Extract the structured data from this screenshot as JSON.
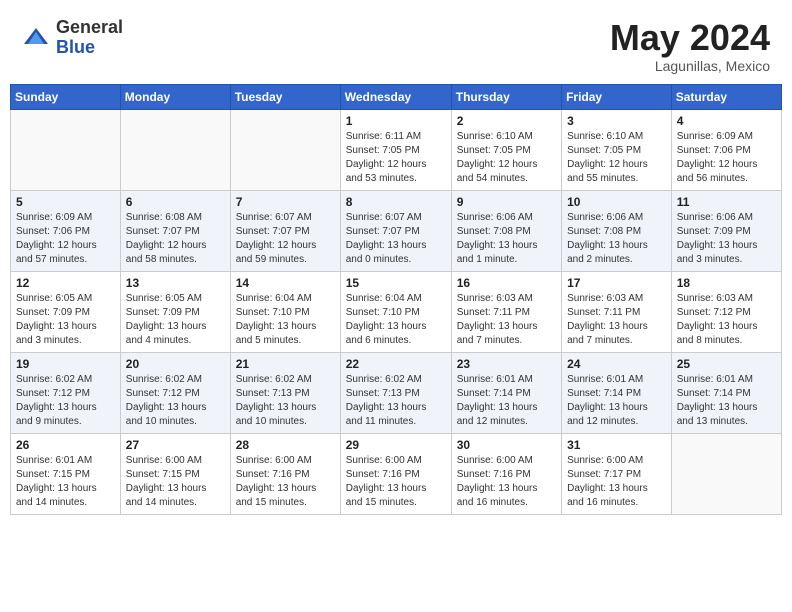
{
  "header": {
    "logo_general": "General",
    "logo_blue": "Blue",
    "month_year": "May 2024",
    "location": "Lagunillas, Mexico"
  },
  "weekdays": [
    "Sunday",
    "Monday",
    "Tuesday",
    "Wednesday",
    "Thursday",
    "Friday",
    "Saturday"
  ],
  "weeks": [
    [
      {
        "day": "",
        "info": ""
      },
      {
        "day": "",
        "info": ""
      },
      {
        "day": "",
        "info": ""
      },
      {
        "day": "1",
        "info": "Sunrise: 6:11 AM\nSunset: 7:05 PM\nDaylight: 12 hours\nand 53 minutes."
      },
      {
        "day": "2",
        "info": "Sunrise: 6:10 AM\nSunset: 7:05 PM\nDaylight: 12 hours\nand 54 minutes."
      },
      {
        "day": "3",
        "info": "Sunrise: 6:10 AM\nSunset: 7:05 PM\nDaylight: 12 hours\nand 55 minutes."
      },
      {
        "day": "4",
        "info": "Sunrise: 6:09 AM\nSunset: 7:06 PM\nDaylight: 12 hours\nand 56 minutes."
      }
    ],
    [
      {
        "day": "5",
        "info": "Sunrise: 6:09 AM\nSunset: 7:06 PM\nDaylight: 12 hours\nand 57 minutes."
      },
      {
        "day": "6",
        "info": "Sunrise: 6:08 AM\nSunset: 7:07 PM\nDaylight: 12 hours\nand 58 minutes."
      },
      {
        "day": "7",
        "info": "Sunrise: 6:07 AM\nSunset: 7:07 PM\nDaylight: 12 hours\nand 59 minutes."
      },
      {
        "day": "8",
        "info": "Sunrise: 6:07 AM\nSunset: 7:07 PM\nDaylight: 13 hours\nand 0 minutes."
      },
      {
        "day": "9",
        "info": "Sunrise: 6:06 AM\nSunset: 7:08 PM\nDaylight: 13 hours\nand 1 minute."
      },
      {
        "day": "10",
        "info": "Sunrise: 6:06 AM\nSunset: 7:08 PM\nDaylight: 13 hours\nand 2 minutes."
      },
      {
        "day": "11",
        "info": "Sunrise: 6:06 AM\nSunset: 7:09 PM\nDaylight: 13 hours\nand 3 minutes."
      }
    ],
    [
      {
        "day": "12",
        "info": "Sunrise: 6:05 AM\nSunset: 7:09 PM\nDaylight: 13 hours\nand 3 minutes."
      },
      {
        "day": "13",
        "info": "Sunrise: 6:05 AM\nSunset: 7:09 PM\nDaylight: 13 hours\nand 4 minutes."
      },
      {
        "day": "14",
        "info": "Sunrise: 6:04 AM\nSunset: 7:10 PM\nDaylight: 13 hours\nand 5 minutes."
      },
      {
        "day": "15",
        "info": "Sunrise: 6:04 AM\nSunset: 7:10 PM\nDaylight: 13 hours\nand 6 minutes."
      },
      {
        "day": "16",
        "info": "Sunrise: 6:03 AM\nSunset: 7:11 PM\nDaylight: 13 hours\nand 7 minutes."
      },
      {
        "day": "17",
        "info": "Sunrise: 6:03 AM\nSunset: 7:11 PM\nDaylight: 13 hours\nand 7 minutes."
      },
      {
        "day": "18",
        "info": "Sunrise: 6:03 AM\nSunset: 7:12 PM\nDaylight: 13 hours\nand 8 minutes."
      }
    ],
    [
      {
        "day": "19",
        "info": "Sunrise: 6:02 AM\nSunset: 7:12 PM\nDaylight: 13 hours\nand 9 minutes."
      },
      {
        "day": "20",
        "info": "Sunrise: 6:02 AM\nSunset: 7:12 PM\nDaylight: 13 hours\nand 10 minutes."
      },
      {
        "day": "21",
        "info": "Sunrise: 6:02 AM\nSunset: 7:13 PM\nDaylight: 13 hours\nand 10 minutes."
      },
      {
        "day": "22",
        "info": "Sunrise: 6:02 AM\nSunset: 7:13 PM\nDaylight: 13 hours\nand 11 minutes."
      },
      {
        "day": "23",
        "info": "Sunrise: 6:01 AM\nSunset: 7:14 PM\nDaylight: 13 hours\nand 12 minutes."
      },
      {
        "day": "24",
        "info": "Sunrise: 6:01 AM\nSunset: 7:14 PM\nDaylight: 13 hours\nand 12 minutes."
      },
      {
        "day": "25",
        "info": "Sunrise: 6:01 AM\nSunset: 7:14 PM\nDaylight: 13 hours\nand 13 minutes."
      }
    ],
    [
      {
        "day": "26",
        "info": "Sunrise: 6:01 AM\nSunset: 7:15 PM\nDaylight: 13 hours\nand 14 minutes."
      },
      {
        "day": "27",
        "info": "Sunrise: 6:00 AM\nSunset: 7:15 PM\nDaylight: 13 hours\nand 14 minutes."
      },
      {
        "day": "28",
        "info": "Sunrise: 6:00 AM\nSunset: 7:16 PM\nDaylight: 13 hours\nand 15 minutes."
      },
      {
        "day": "29",
        "info": "Sunrise: 6:00 AM\nSunset: 7:16 PM\nDaylight: 13 hours\nand 15 minutes."
      },
      {
        "day": "30",
        "info": "Sunrise: 6:00 AM\nSunset: 7:16 PM\nDaylight: 13 hours\nand 16 minutes."
      },
      {
        "day": "31",
        "info": "Sunrise: 6:00 AM\nSunset: 7:17 PM\nDaylight: 13 hours\nand 16 minutes."
      },
      {
        "day": "",
        "info": ""
      }
    ]
  ]
}
